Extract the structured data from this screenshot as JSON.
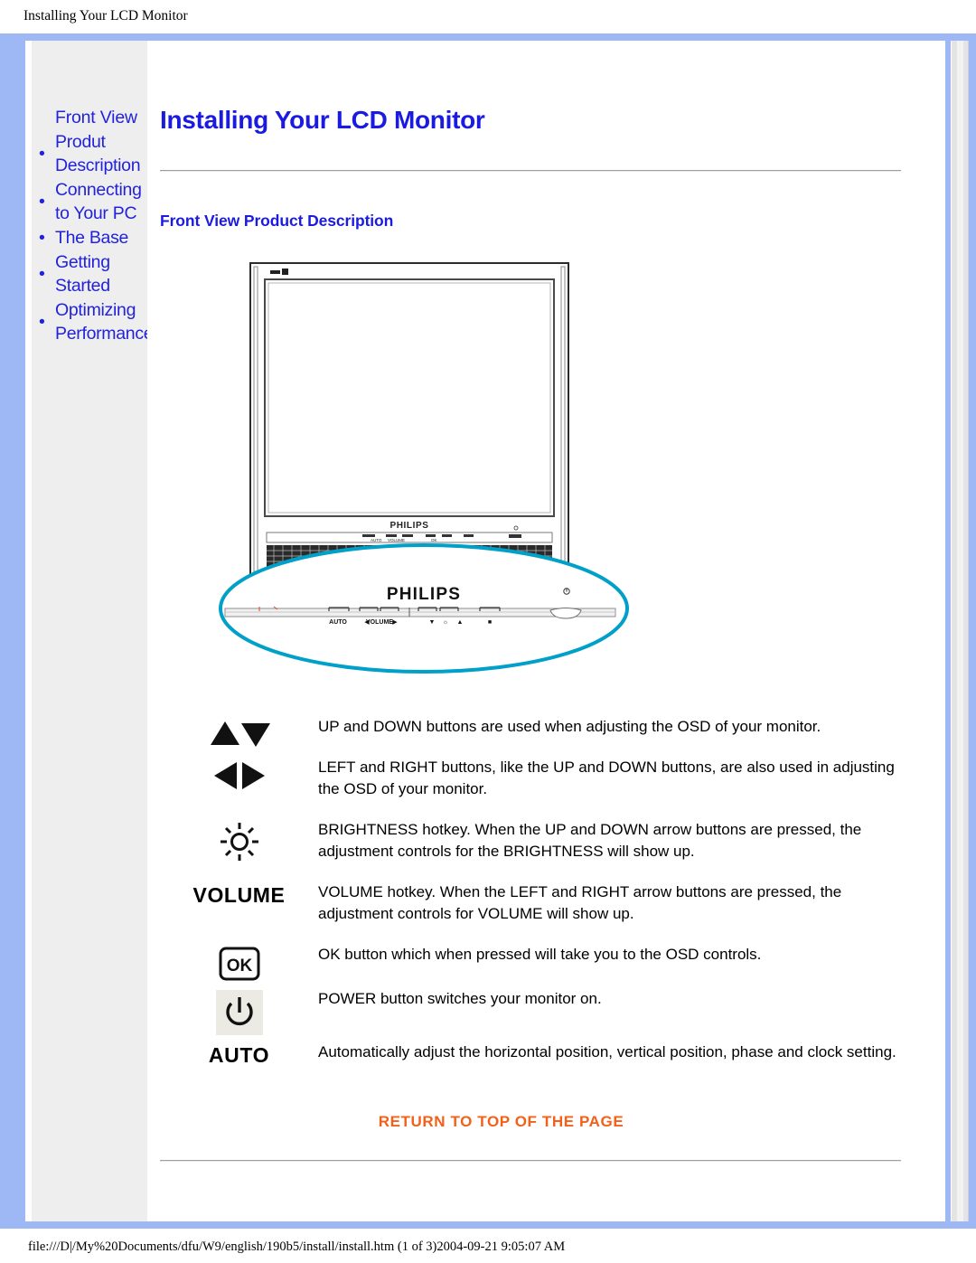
{
  "browser": {
    "header_title": "Installing Your LCD Monitor",
    "footer_path": "file:///D|/My%20Documents/dfu/W9/english/190b5/install/install.htm (1 of 3)2004-09-21 9:05:07 AM"
  },
  "sidebar": {
    "first_label": "Front View",
    "items": [
      {
        "bullet": "•",
        "label": "Produt Description"
      },
      {
        "bullet": "•",
        "label": "Connecting to Your PC"
      },
      {
        "bullet": "•",
        "label": "The Base"
      },
      {
        "bullet": "•",
        "label": "Getting Started"
      },
      {
        "bullet": "•",
        "label": "Optimizing Performance"
      }
    ]
  },
  "main": {
    "page_title": "Installing Your LCD Monitor",
    "section_title": "Front View Product Description",
    "return_link": "RETURN TO TOP OF THE PAGE"
  },
  "figure": {
    "brand_logo": "PHILIPS",
    "panel_labels": {
      "auto": "AUTO",
      "volume": "VOLUME",
      "volume_left": "◀",
      "volume_right": "▶",
      "down": "▼",
      "brightness": "☼",
      "up": "▲",
      "ok": "■"
    }
  },
  "buttons": [
    {
      "icon": "up-down-arrows-icon",
      "icon_label": "",
      "description": "UP and DOWN buttons are used when adjusting the OSD of your monitor."
    },
    {
      "icon": "left-right-arrows-icon",
      "icon_label": "",
      "description": "LEFT and RIGHT buttons, like the UP and DOWN buttons, are also used in adjusting the OSD of your monitor."
    },
    {
      "icon": "brightness-sun-icon",
      "icon_label": "",
      "description": "BRIGHTNESS hotkey. When the UP and DOWN arrow buttons are pressed, the adjustment controls for the BRIGHTNESS will show up."
    },
    {
      "icon": "volume-text-icon",
      "icon_label": "VOLUME",
      "description": "VOLUME hotkey. When the LEFT and RIGHT arrow buttons are pressed, the adjustment controls for VOLUME will show up."
    },
    {
      "icon": "ok-button-icon",
      "icon_label": "OK",
      "description": "OK button which when pressed will take you to the OSD controls."
    },
    {
      "icon": "power-button-icon",
      "icon_label": "",
      "description": "POWER button switches your monitor on."
    },
    {
      "icon": "auto-text-icon",
      "icon_label": "AUTO",
      "description": "Automatically adjust the horizontal position, vertical position, phase and clock setting."
    }
  ],
  "colors": {
    "frame_blue": "#9eb8f5",
    "heading_blue": "#1a1ae0",
    "link_blue": "#2222dd",
    "return_orange": "#f4601a",
    "sidebar_gray": "#eeeeee",
    "highlight_cyan": "#00a0c8"
  }
}
